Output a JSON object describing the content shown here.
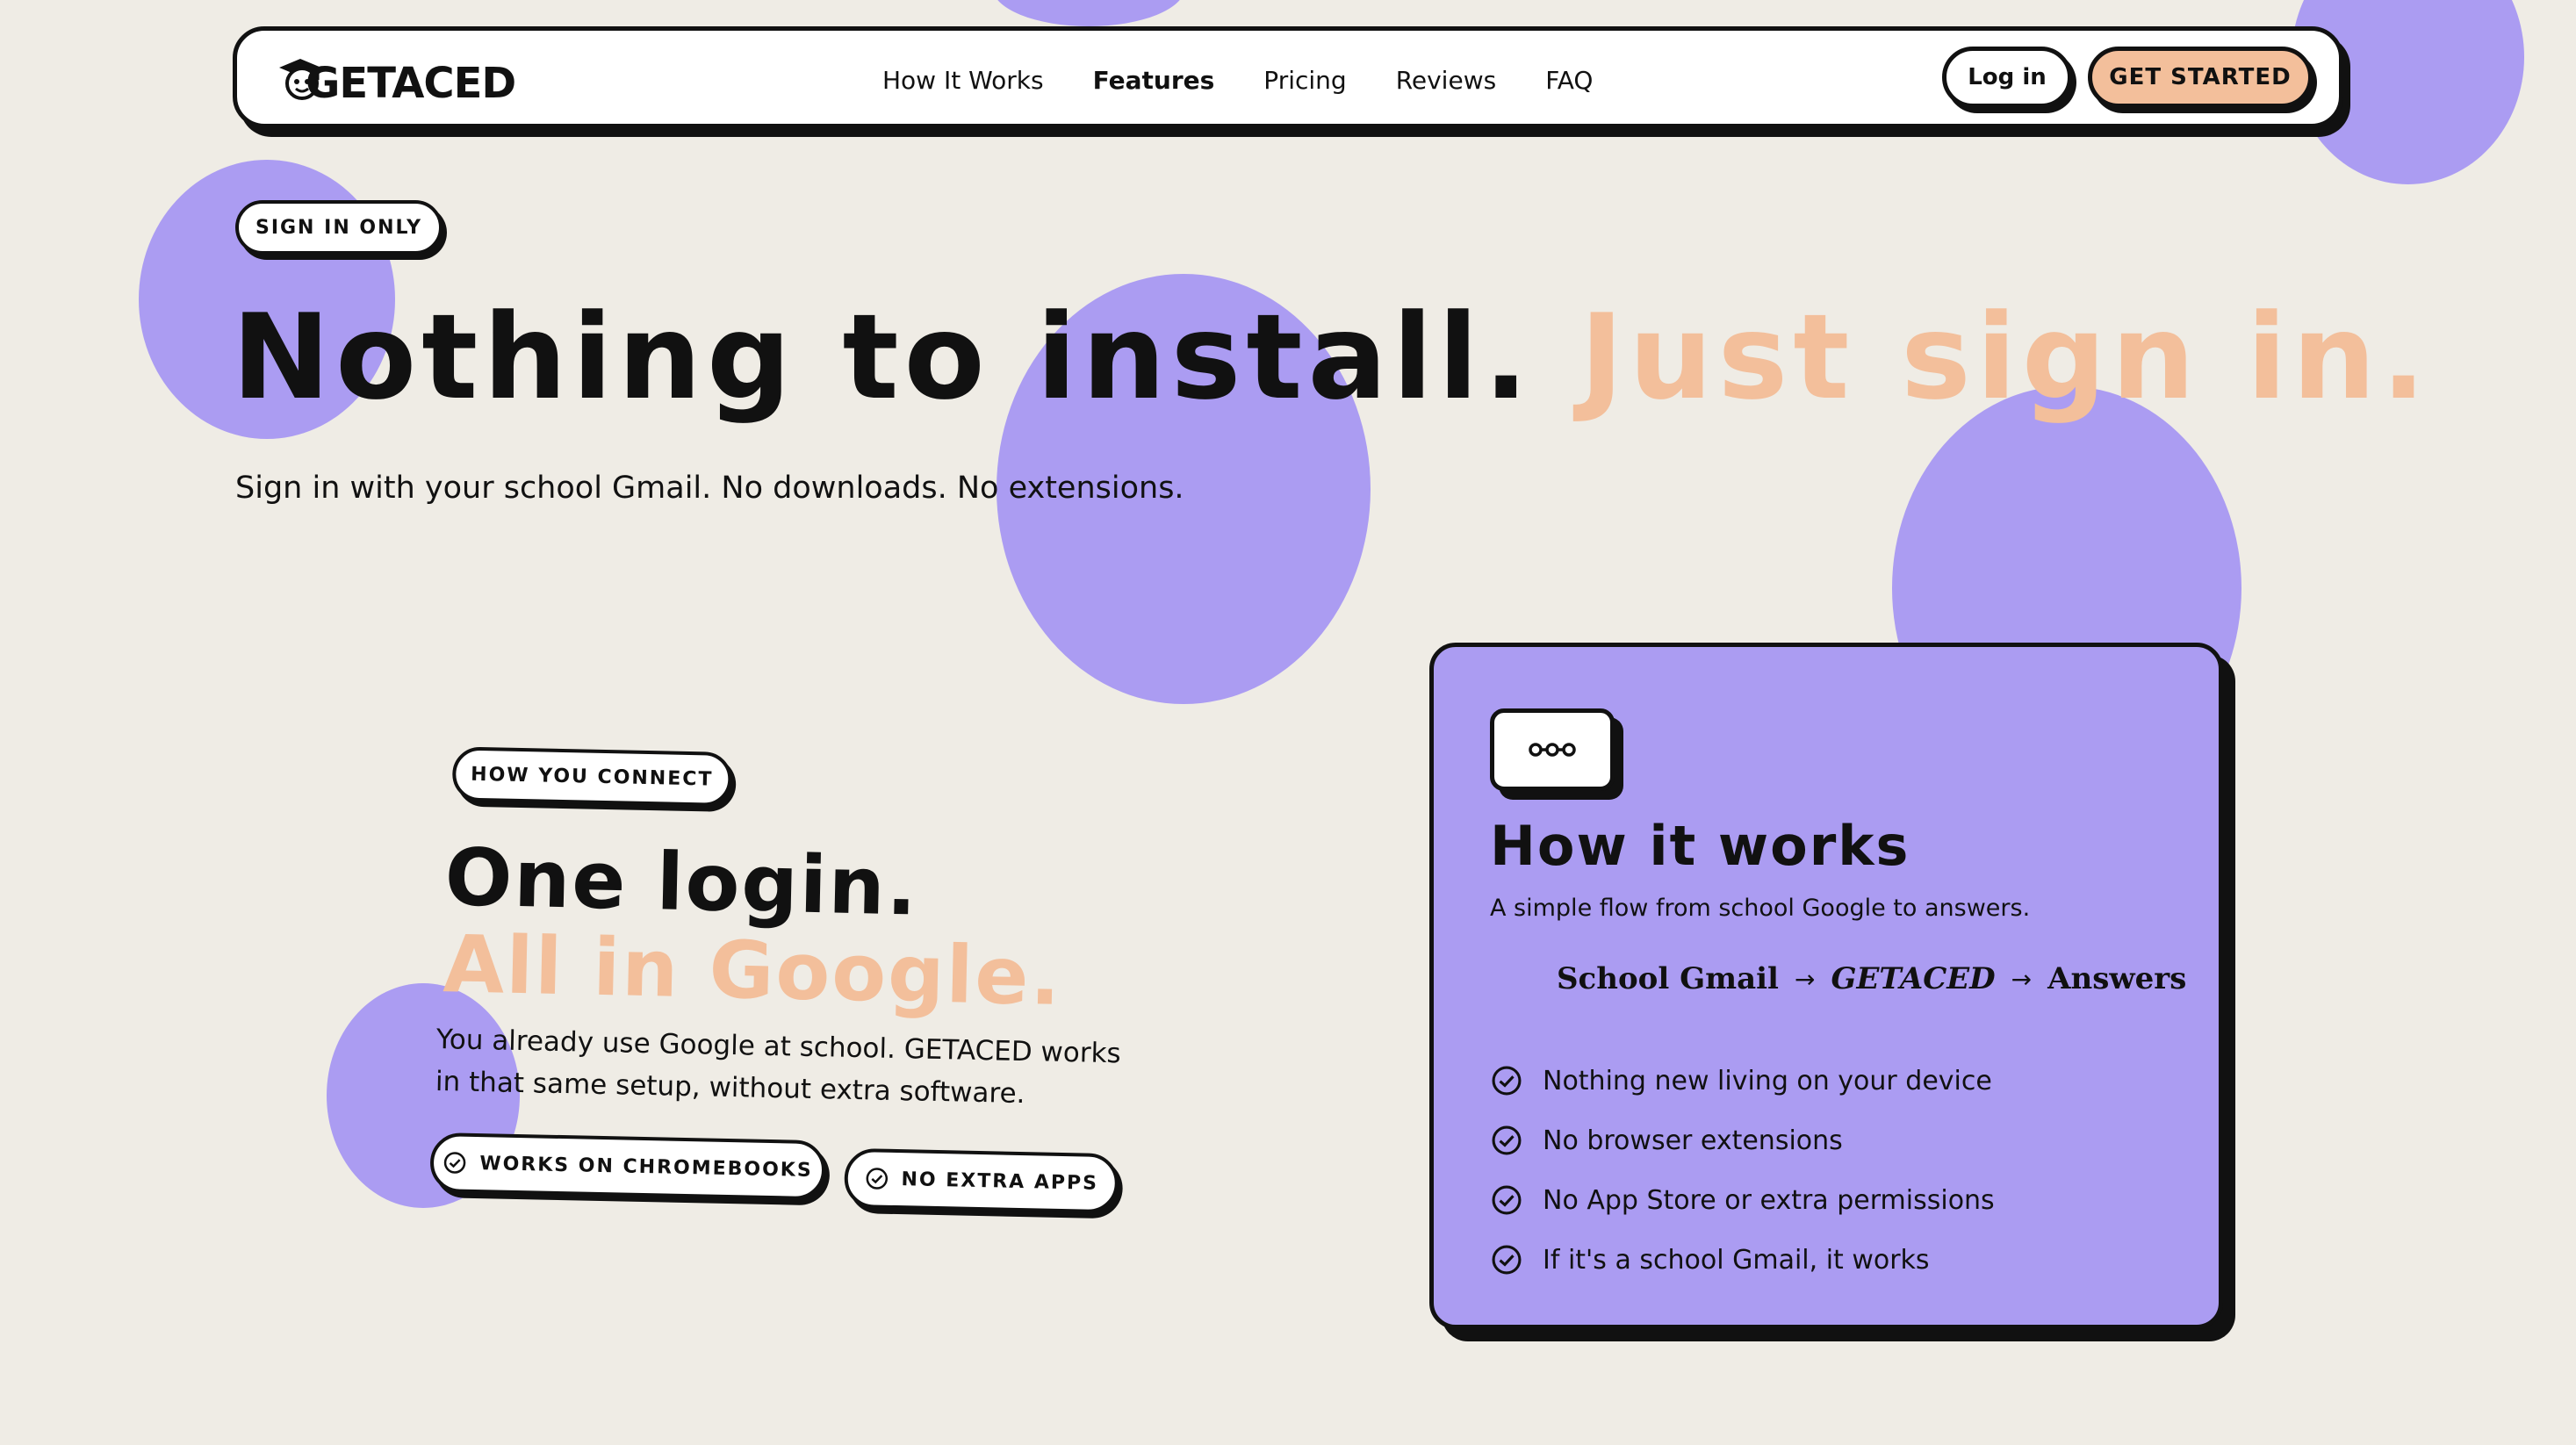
{
  "nav": {
    "logo_text": "GETACED",
    "links": [
      {
        "label": "How It Works",
        "active": false
      },
      {
        "label": "Features",
        "active": true
      },
      {
        "label": "Pricing",
        "active": false
      },
      {
        "label": "Reviews",
        "active": false
      },
      {
        "label": "FAQ",
        "active": false
      }
    ],
    "login_label": "Log in",
    "cta_label": "GET STARTED"
  },
  "hero": {
    "badge": "SIGN IN ONLY",
    "title_main": "Nothing to install.",
    "title_accent": "Just sign in.",
    "subtitle": "Sign in with your school Gmail. No downloads. No extensions."
  },
  "connect": {
    "badge": "HOW YOU CONNECT",
    "title_line1": "One login.",
    "title_line2": "All in Google.",
    "body": "You already use Google at school. GETACED works in that same setup, without extra software.",
    "tags": [
      "WORKS ON CHROMEBOOKS",
      "NO EXTRA APPS"
    ]
  },
  "card": {
    "icon": "link-chain-icon",
    "title": "How it works",
    "subtitle": "A simple flow from school Google to answers.",
    "flow": [
      "School Gmail",
      "GETACED",
      "Answers"
    ],
    "flow_arrow": "→",
    "items": [
      "Nothing new living on your device",
      "No browser extensions",
      "No App Store or extra permissions",
      "If it's a school Gmail, it works"
    ]
  },
  "colors": {
    "background": "#efece5",
    "blob": "#ab9cf2",
    "accent": "#f3bf9b",
    "ink": "#111111"
  }
}
